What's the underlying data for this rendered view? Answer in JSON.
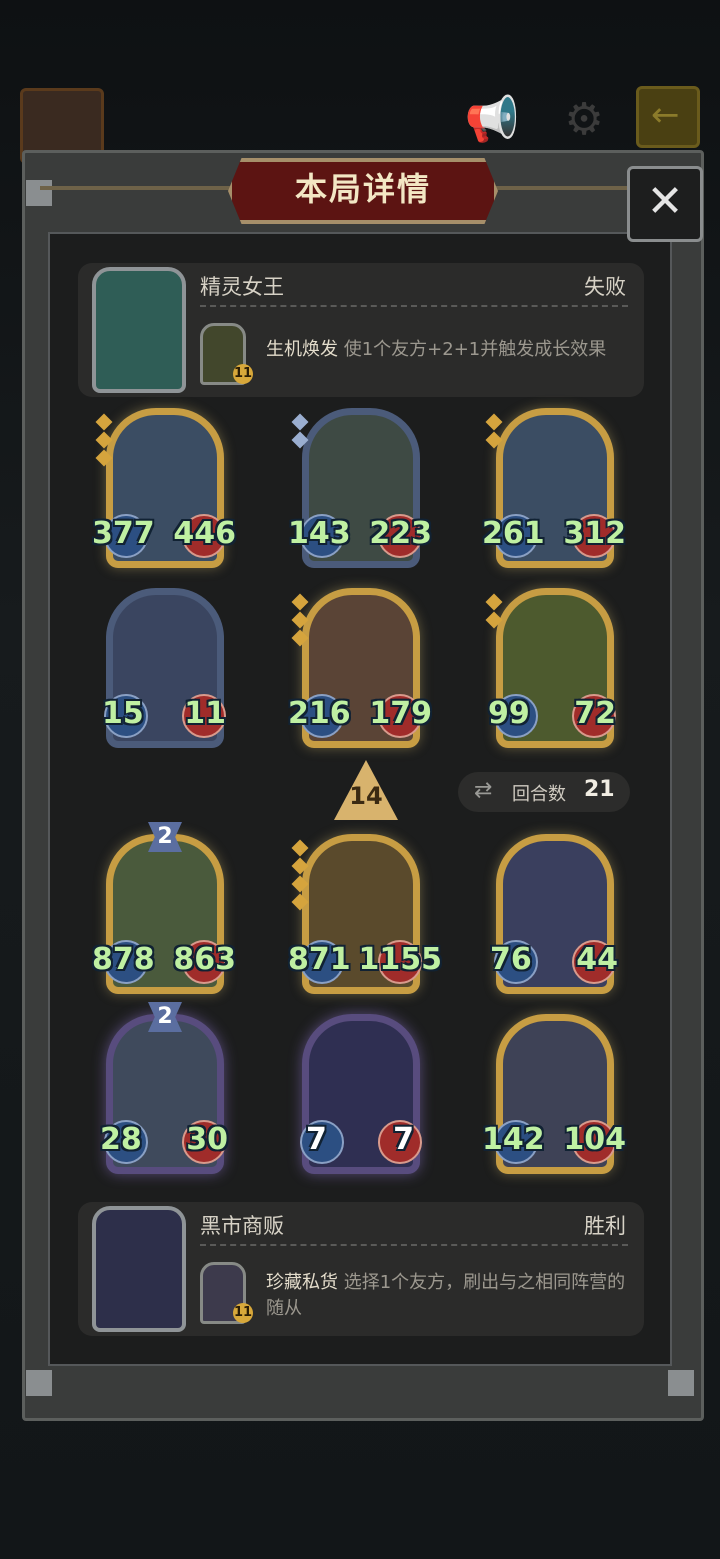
{
  "dialog": {
    "title": "本局详情",
    "close_icon": "✕"
  },
  "opponent": {
    "name": "精灵女王",
    "result": "失败",
    "skill_name": "生机焕发",
    "skill_desc": "使1个友方+2+1并触发成长效果",
    "skill_level": "11"
  },
  "opponent_board": [
    {
      "atk": "377",
      "hp": "446"
    },
    {
      "atk": "143",
      "hp": "223"
    },
    {
      "atk": "261",
      "hp": "312"
    },
    {
      "atk": "15",
      "hp": "11"
    },
    {
      "atk": "216",
      "hp": "179"
    },
    {
      "atk": "99",
      "hp": "72"
    }
  ],
  "tier": {
    "value": "14"
  },
  "round": {
    "label": "回合数",
    "value": "21"
  },
  "player_board": [
    {
      "atk": "878",
      "hp": "863",
      "level": "2"
    },
    {
      "atk": "871",
      "hp": "1155"
    },
    {
      "atk": "76",
      "hp": "44"
    },
    {
      "atk": "28",
      "hp": "30",
      "level": "2"
    },
    {
      "atk": "7",
      "hp": "7"
    },
    {
      "atk": "142",
      "hp": "104"
    }
  ],
  "player": {
    "name": "黑市商贩",
    "result": "胜利",
    "skill_name": "珍藏私货",
    "skill_desc": "选择1个友方，刷出与之相同阵营的随从",
    "skill_level": "11"
  },
  "colors": {
    "accent_gold": "#c79d43",
    "title_red": "#5c1412",
    "stat_green": "#bff0a2"
  }
}
